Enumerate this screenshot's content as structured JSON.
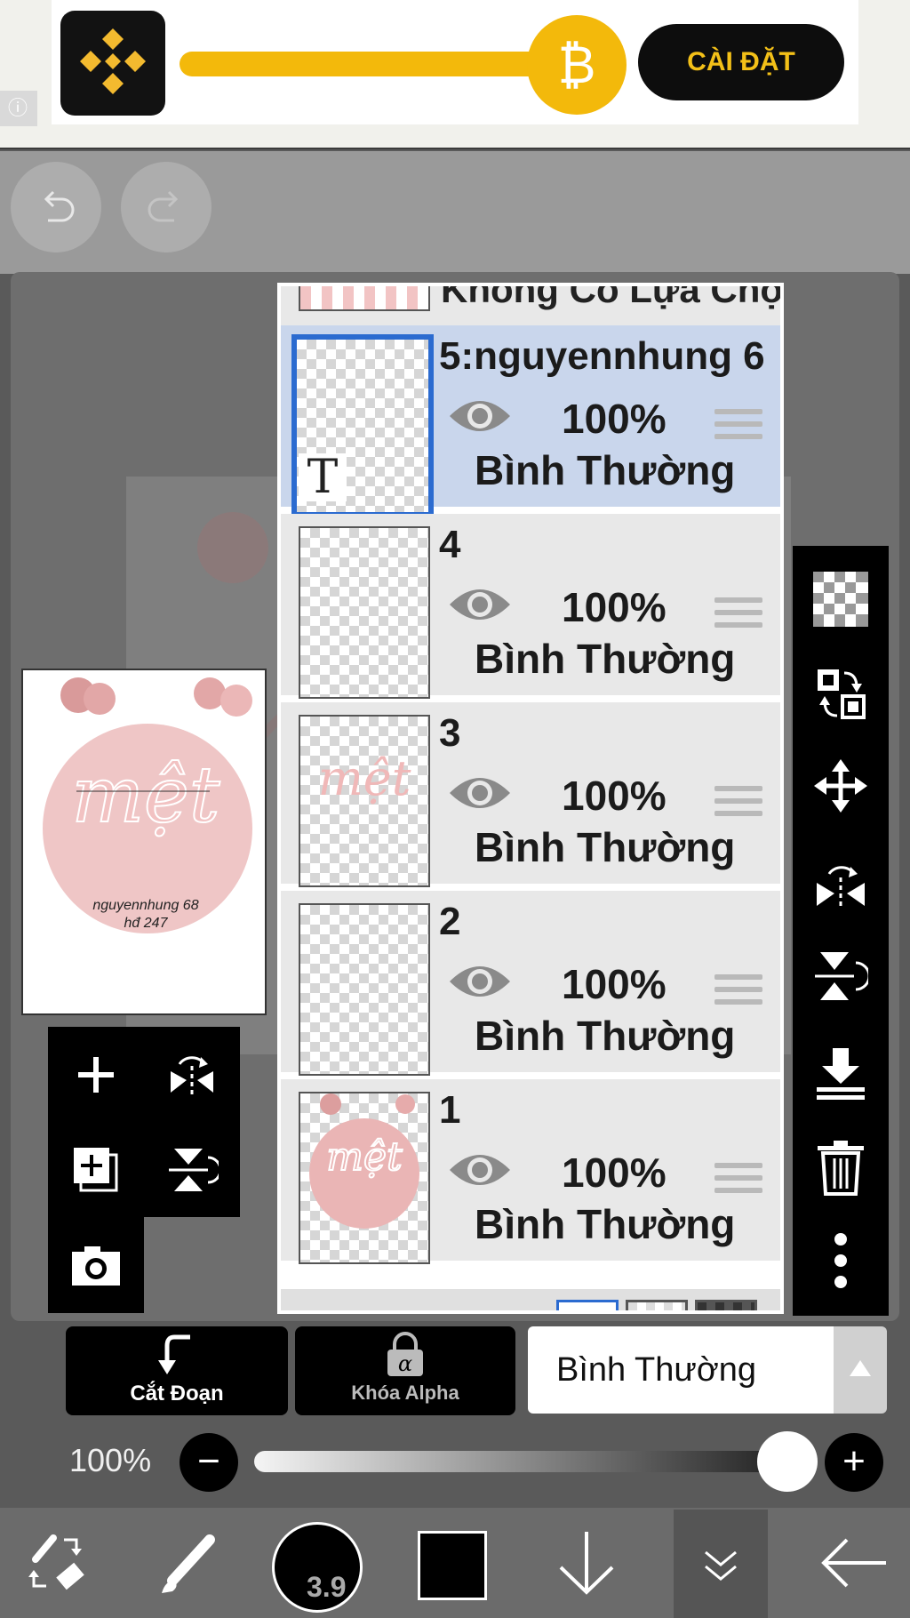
{
  "ad": {
    "install_label": "CÀI ĐẶT",
    "coin_symbol": "₿",
    "info_symbol": "ⓘ",
    "brand_color": "#F3BA2F"
  },
  "toolbar": {
    "undo_icon": "undo-icon",
    "redo_icon": "redo-icon"
  },
  "preview": {
    "caption_line1": "nguyennhung 68",
    "caption_line2": "hđ 247"
  },
  "layers": {
    "top_partial_label": "Không Có Lựa Chọn",
    "items": [
      {
        "name": "5:nguyennhung 6",
        "opacity": "100%",
        "blend": "Bình Thường",
        "selected": true,
        "thumb_text": "T"
      },
      {
        "name": "4",
        "opacity": "100%",
        "blend": "Bình Thường",
        "selected": false
      },
      {
        "name": "3",
        "opacity": "100%",
        "blend": "Bình Thường",
        "selected": false
      },
      {
        "name": "2",
        "opacity": "100%",
        "blend": "Bình Thường",
        "selected": false
      },
      {
        "name": "1",
        "opacity": "100%",
        "blend": "Bình Thường",
        "selected": false
      }
    ]
  },
  "bottom": {
    "clip_label": "Cắt Đoạn",
    "alpha_lock_label": "Khóa Alpha",
    "alpha_lock_symbol": "α",
    "blend_mode": "Bình Thường",
    "opacity_value": "100%",
    "minus": "−",
    "plus": "+",
    "brush_size": "3.9",
    "selection_color": "#2b6bd0"
  }
}
